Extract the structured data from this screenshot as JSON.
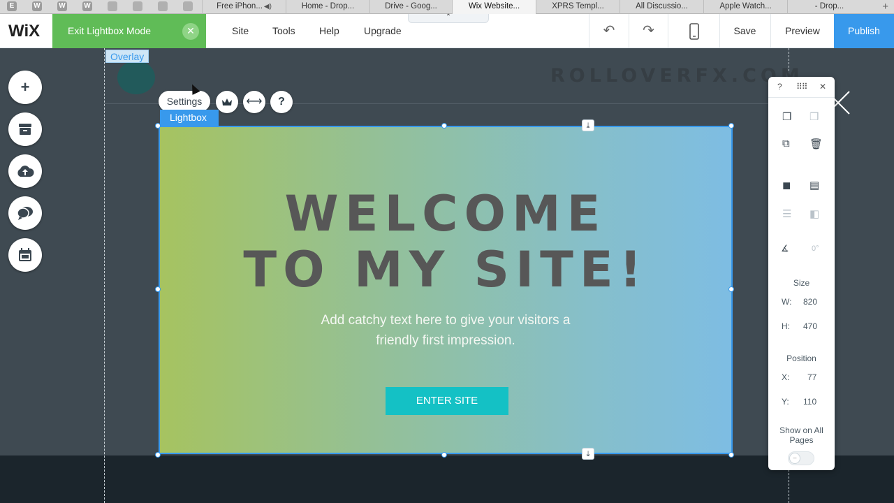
{
  "browser": {
    "pinned_tabs": [
      "E",
      "W",
      "W",
      "W"
    ],
    "tabs": [
      {
        "label": "Free iPhon...",
        "audio": true
      },
      {
        "label": "Home - Drop..."
      },
      {
        "label": "Drive - Goog..."
      },
      {
        "label": "Wix Website...",
        "active": true
      },
      {
        "label": "XPRS Templ..."
      },
      {
        "label": "All Discussio..."
      },
      {
        "label": "Apple Watch..."
      },
      {
        "label": "- Drop..."
      }
    ],
    "new_tab_label": "+"
  },
  "topbar": {
    "logo": "WiX",
    "exit_lightbox_label": "Exit Lightbox Mode",
    "collapse_glyph": "⌃",
    "menu": [
      "Site",
      "Tools",
      "Help",
      "Upgrade"
    ],
    "undo_icon": "undo-icon",
    "redo_icon": "redo-icon",
    "mobile_icon": "mobile-icon",
    "save_label": "Save",
    "preview_label": "Preview",
    "publish_label": "Publish",
    "publish_color": "#3899ec",
    "exit_color": "#60bc57"
  },
  "canvas": {
    "overlay_label": "Overlay",
    "watermark": "ROLLOVERFX.COM",
    "settings_label": "Settings",
    "lightbox_label": "Lightbox",
    "heading": "WELCOME\nTO MY SITE!",
    "subtext": "Add catchy text here to give your visitors a\nfriendly first impression.",
    "button_label": "ENTER SITE",
    "button_color": "#14c1c5"
  },
  "left_tools": [
    "add-icon",
    "store-icon",
    "upload-icon",
    "chat-icon",
    "calendar-icon"
  ],
  "panel": {
    "help": "?",
    "rotation": "0°",
    "size_label": "Size",
    "w_label": "W:",
    "w_value": "820",
    "h_label": "H:",
    "h_value": "470",
    "position_label": "Position",
    "x_label": "X:",
    "x_value": "77",
    "y_label": "Y:",
    "y_value": "110",
    "show_all_label": "Show on All\nPages",
    "show_all_enabled": false
  }
}
